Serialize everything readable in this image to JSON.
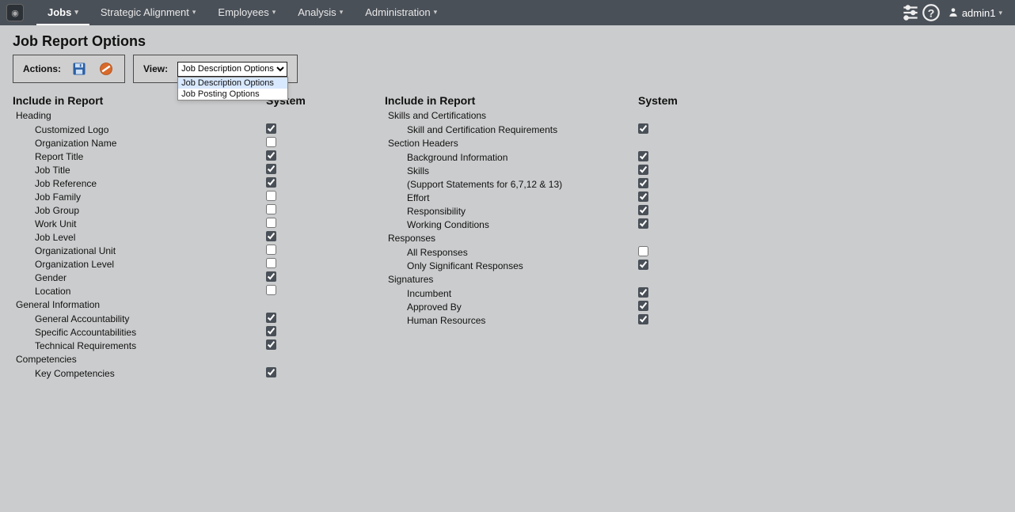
{
  "nav": {
    "items": [
      {
        "label": "Jobs",
        "active": true
      },
      {
        "label": "Strategic Alignment",
        "active": false
      },
      {
        "label": "Employees",
        "active": false
      },
      {
        "label": "Analysis",
        "active": false
      },
      {
        "label": "Administration",
        "active": false
      }
    ],
    "user": "admin1"
  },
  "page": {
    "title": "Job Report Options",
    "actions_label": "Actions:",
    "view_label": "View:",
    "view_selected": "Job Description Options",
    "view_options": [
      "Job Description Options",
      "Job Posting Options"
    ]
  },
  "headers": {
    "include": "Include in Report",
    "system": "System"
  },
  "left": [
    {
      "group": "Heading",
      "rows": [
        {
          "label": "Customized Logo",
          "checked": true
        },
        {
          "label": "Organization Name",
          "checked": false
        },
        {
          "label": "Report Title",
          "checked": true
        },
        {
          "label": "Job Title",
          "checked": true
        },
        {
          "label": "Job Reference",
          "checked": true
        },
        {
          "label": "Job Family",
          "checked": false
        },
        {
          "label": "Job Group",
          "checked": false
        },
        {
          "label": "Work Unit",
          "checked": false
        },
        {
          "label": "Job Level",
          "checked": true
        },
        {
          "label": "Organizational Unit",
          "checked": false
        },
        {
          "label": "Organization Level",
          "checked": false
        },
        {
          "label": "Gender",
          "checked": true
        },
        {
          "label": "Location",
          "checked": false
        }
      ]
    },
    {
      "group": "General Information",
      "rows": [
        {
          "label": "General Accountability",
          "checked": true
        },
        {
          "label": "Specific Accountabilities",
          "checked": true
        },
        {
          "label": "Technical Requirements",
          "checked": true
        }
      ]
    },
    {
      "group": "Competencies",
      "rows": [
        {
          "label": "Key Competencies",
          "checked": true
        }
      ]
    }
  ],
  "right": [
    {
      "group": "Skills and Certifications",
      "rows": [
        {
          "label": "Skill and Certification Requirements",
          "checked": true
        }
      ]
    },
    {
      "group": "Section Headers",
      "rows": [
        {
          "label": "Background Information",
          "checked": true
        },
        {
          "label": "Skills",
          "checked": true
        },
        {
          "label": "(Support Statements for 6,7,12 & 13)",
          "checked": true
        },
        {
          "label": "Effort",
          "checked": true
        },
        {
          "label": "Responsibility",
          "checked": true
        },
        {
          "label": "Working Conditions",
          "checked": true
        }
      ]
    },
    {
      "group": "Responses",
      "rows": [
        {
          "label": "All Responses",
          "checked": false
        },
        {
          "label": "Only Significant Responses",
          "checked": true
        }
      ]
    },
    {
      "group": "Signatures",
      "rows": [
        {
          "label": "Incumbent",
          "checked": true
        },
        {
          "label": "Approved By",
          "checked": true
        },
        {
          "label": "Human Resources",
          "checked": true
        }
      ]
    }
  ]
}
